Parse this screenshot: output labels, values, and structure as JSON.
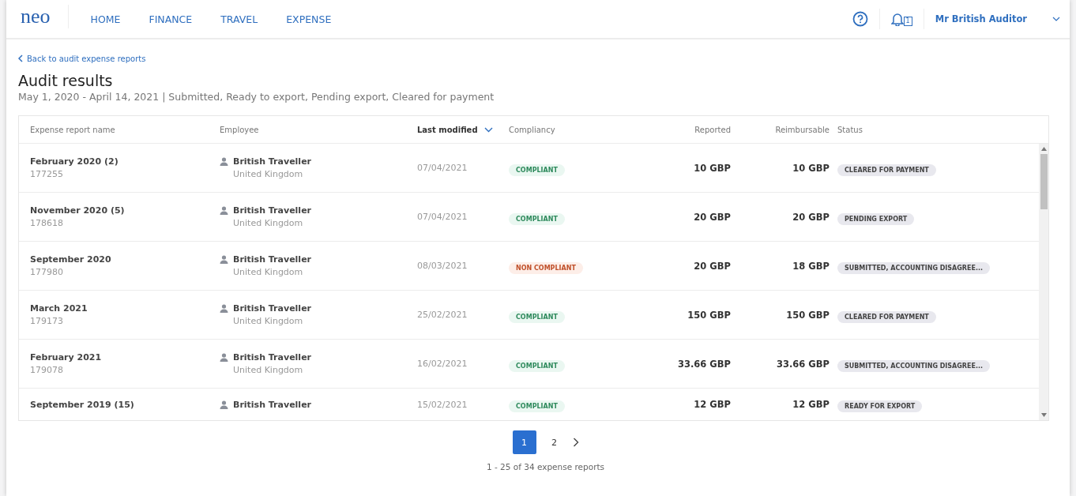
{
  "nav": {
    "logo": "neo",
    "items": [
      {
        "label": "HOME",
        "selected": false
      },
      {
        "label": "FINANCE",
        "selected": false
      },
      {
        "label": "TRAVEL",
        "selected": false
      },
      {
        "label": "EXPENSE",
        "selected": false
      }
    ],
    "notification_count": "1",
    "user": "Mr British Auditor"
  },
  "back_link": "Back to audit expense reports",
  "title": "Audit results",
  "subtitle": "May 1, 2020 - April 14, 2021 | Submitted, Ready to export, Pending export, Cleared for payment",
  "table": {
    "columns": [
      {
        "label": "Expense report name",
        "sorted": false
      },
      {
        "label": "Employee",
        "sorted": false
      },
      {
        "label": "Last modified",
        "sorted": true
      },
      {
        "label": "Compliancy",
        "sorted": false
      },
      {
        "label": "Reported",
        "sorted": false
      },
      {
        "label": "Reimbursable",
        "sorted": false
      },
      {
        "label": "Status",
        "sorted": false
      }
    ],
    "rows": [
      {
        "name": "February 2020 (2)",
        "id": "177255",
        "employee": "British Traveller",
        "country": "United Kingdom",
        "modified": "07/04/2021",
        "compliancy": {
          "kind": "compliant",
          "label": "COMPLIANT"
        },
        "reported": "10 GBP",
        "reimbursable": "10 GBP",
        "status": "CLEARED FOR PAYMENT"
      },
      {
        "name": "November 2020 (5)",
        "id": "178618",
        "employee": "British Traveller",
        "country": "United Kingdom",
        "modified": "07/04/2021",
        "compliancy": {
          "kind": "compliant",
          "label": "COMPLIANT"
        },
        "reported": "20 GBP",
        "reimbursable": "20 GBP",
        "status": "PENDING EXPORT"
      },
      {
        "name": "September 2020",
        "id": "177980",
        "employee": "British Traveller",
        "country": "United Kingdom",
        "modified": "08/03/2021",
        "compliancy": {
          "kind": "non_compliant",
          "label": "NON COMPLIANT"
        },
        "reported": "20 GBP",
        "reimbursable": "18 GBP",
        "status": "SUBMITTED, ACCOUNTING DISAGREE..."
      },
      {
        "name": "March 2021",
        "id": "179173",
        "employee": "British Traveller",
        "country": "United Kingdom",
        "modified": "25/02/2021",
        "compliancy": {
          "kind": "compliant",
          "label": "COMPLIANT"
        },
        "reported": "150 GBP",
        "reimbursable": "150 GBP",
        "status": "CLEARED FOR PAYMENT"
      },
      {
        "name": "February 2021",
        "id": "179078",
        "employee": "British Traveller",
        "country": "United Kingdom",
        "modified": "16/02/2021",
        "compliancy": {
          "kind": "compliant",
          "label": "COMPLIANT"
        },
        "reported": "33.66 GBP",
        "reimbursable": "33.66 GBP",
        "status": "SUBMITTED, ACCOUNTING DISAGREE..."
      },
      {
        "name": "September 2019 (15)",
        "employee": "British Traveller",
        "modified": "15/02/2021",
        "compliancy": {
          "kind": "compliant",
          "label": "COMPLIANT"
        },
        "reported": "12 GBP",
        "reimbursable": "12 GBP",
        "status": "READY FOR EXPORT"
      }
    ]
  },
  "pagination": {
    "pages": [
      {
        "label": "1",
        "selected": true
      },
      {
        "label": "2",
        "selected": false
      }
    ],
    "summary": "1 - 25 of 34 expense reports"
  }
}
